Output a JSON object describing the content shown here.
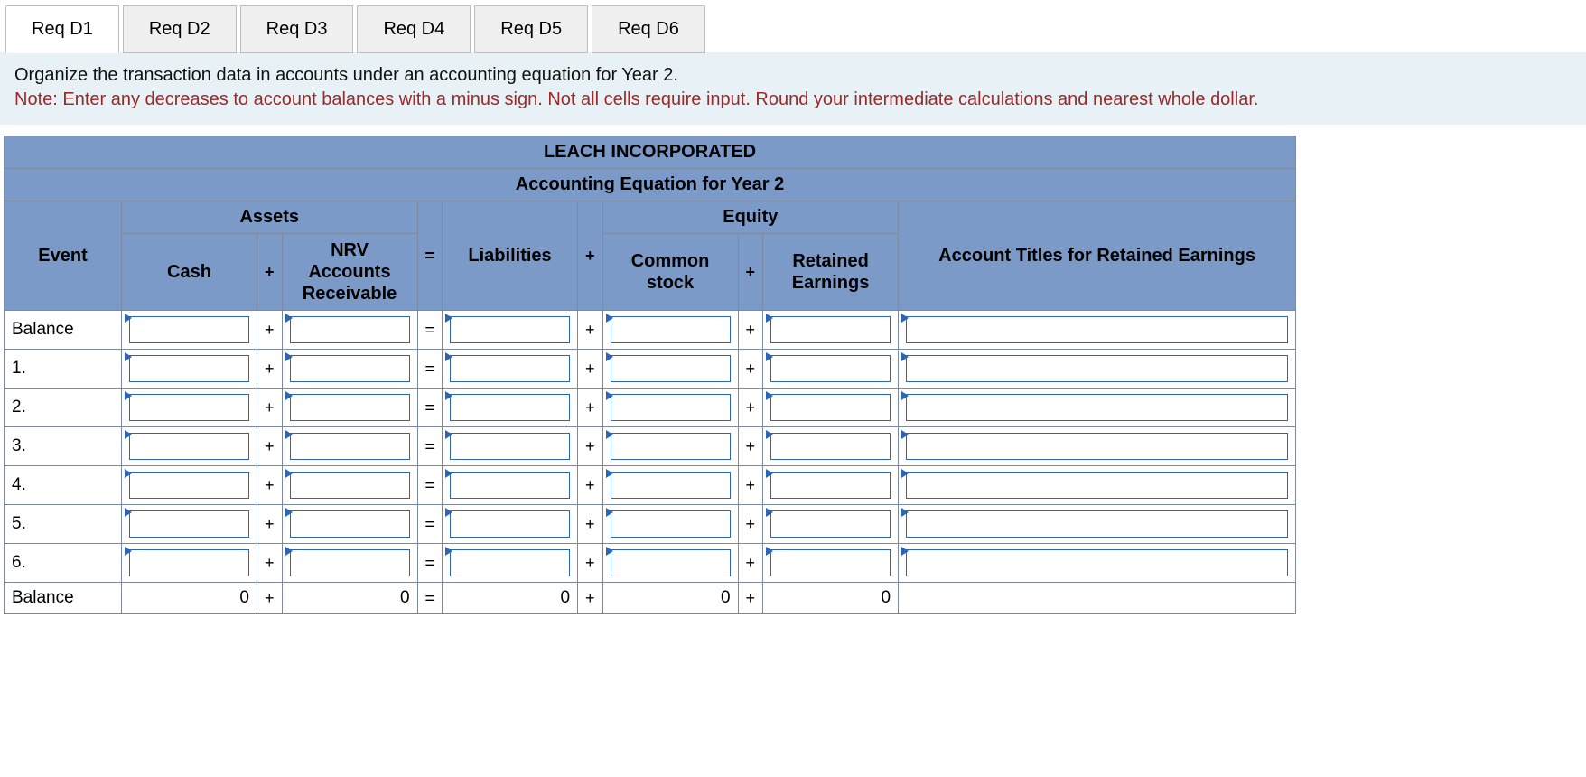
{
  "tabs": [
    {
      "label": "Req D1",
      "active": true
    },
    {
      "label": "Req D2",
      "active": false
    },
    {
      "label": "Req D3",
      "active": false
    },
    {
      "label": "Req D4",
      "active": false
    },
    {
      "label": "Req D5",
      "active": false
    },
    {
      "label": "Req D6",
      "active": false
    }
  ],
  "instructions": {
    "main": "Organize the transaction data in accounts under an accounting equation for Year 2.",
    "note": "Note: Enter any decreases to account balances with a minus sign. Not all cells require input. Round your intermediate calculations and nearest whole dollar."
  },
  "table": {
    "company": "LEACH INCORPORATED",
    "subtitle": "Accounting Equation for Year 2",
    "sections": {
      "assets": "Assets",
      "equity": "Equity"
    },
    "headers": {
      "event": "Event",
      "cash": "Cash",
      "ar": "NRV\nAccounts\nReceivable",
      "liab": "Liabilities",
      "cs": "Common\nstock",
      "re": "Retained\nEarnings",
      "titles": "Account Titles for Retained Earnings"
    },
    "ops": {
      "plus": "+",
      "equals": "="
    },
    "rows": [
      {
        "label": "Balance"
      },
      {
        "label": "1."
      },
      {
        "label": "2."
      },
      {
        "label": "3."
      },
      {
        "label": "4."
      },
      {
        "label": "5."
      },
      {
        "label": "6."
      }
    ],
    "totals": {
      "label": "Balance",
      "cash": "0",
      "ar": "0",
      "liab": "0",
      "cs": "0",
      "re": "0"
    }
  }
}
